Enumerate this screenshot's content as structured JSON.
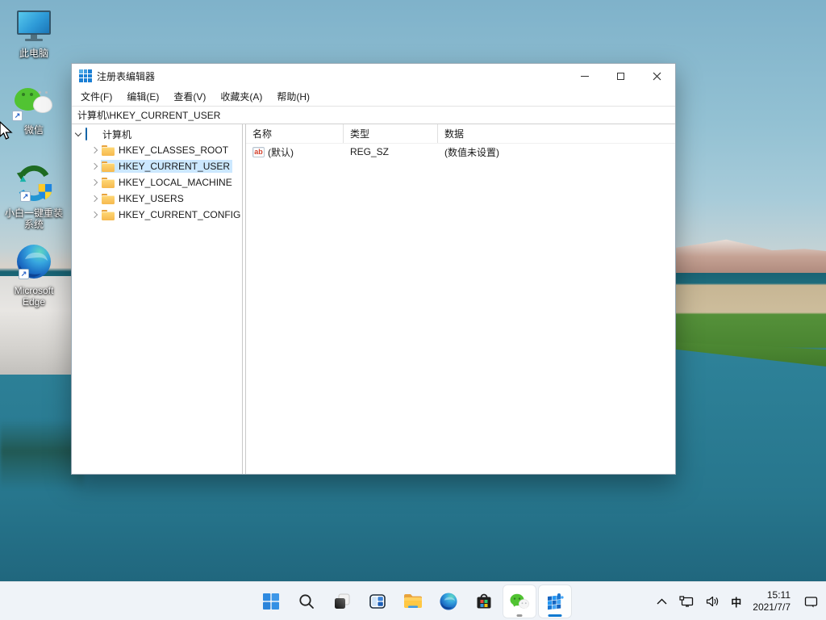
{
  "desktop": {
    "icons": [
      {
        "label": "此电脑"
      },
      {
        "label": "微信"
      },
      {
        "lines": [
          "小白一键重装",
          "系统"
        ]
      },
      {
        "lines": [
          "Microsoft",
          "Edge"
        ]
      }
    ]
  },
  "window": {
    "title": "注册表编辑器",
    "menu": [
      "文件(F)",
      "编辑(E)",
      "查看(V)",
      "收藏夹(A)",
      "帮助(H)"
    ],
    "address": "计算机\\HKEY_CURRENT_USER",
    "tree": {
      "root": {
        "label": "计算机"
      },
      "items": [
        {
          "label": "HKEY_CLASSES_ROOT",
          "selected": false
        },
        {
          "label": "HKEY_CURRENT_USER",
          "selected": true
        },
        {
          "label": "HKEY_LOCAL_MACHINE",
          "selected": false
        },
        {
          "label": "HKEY_USERS",
          "selected": false
        },
        {
          "label": "HKEY_CURRENT_CONFIG",
          "selected": false
        }
      ]
    },
    "list": {
      "columns": [
        "名称",
        "类型",
        "数据"
      ],
      "rows": [
        {
          "icon_text": "ab",
          "name": "(默认)",
          "type": "REG_SZ",
          "data": "(数值未设置)"
        }
      ]
    }
  },
  "taskbar": {
    "tray": {
      "ime": "中",
      "time": "15:11",
      "date": "2021/7/7"
    }
  },
  "colors": {
    "accent": "#0078d4",
    "selection": "#cce8ff",
    "taskbar_bg": "#eff3f8",
    "titlebar_bg": "#ffffff",
    "folder": "#f6b94e"
  }
}
